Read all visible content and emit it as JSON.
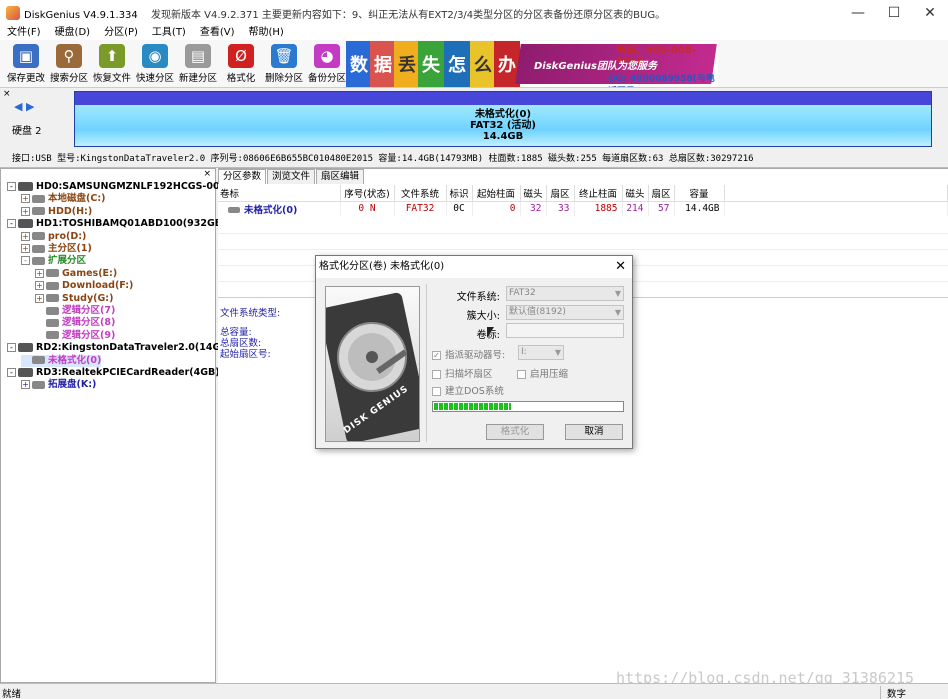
{
  "window": {
    "app_title": "DiskGenius V4.9.1.334",
    "update_notice": "发现新版本 V4.9.2.371 主要更新内容如下：9、纠正无法从有EXT2/3/4类型分区的分区表备份还原分区表的BUG。",
    "minimize": "—",
    "maximize": "☐",
    "close": "✕"
  },
  "menu": [
    "文件(F)",
    "硬盘(D)",
    "分区(P)",
    "工具(T)",
    "查看(V)",
    "帮助(H)"
  ],
  "toolbar": {
    "buttons": [
      {
        "label": "保存更改",
        "icon": "save-icon",
        "color": "#3a6fc4",
        "glyph": "▣"
      },
      {
        "label": "搜索分区",
        "icon": "search-icon",
        "color": "#9a6a3a",
        "glyph": "⚲"
      },
      {
        "label": "恢复文件",
        "icon": "recover-file-icon",
        "color": "#7a9a2a",
        "glyph": "⬆"
      },
      {
        "label": "快速分区",
        "icon": "quick-partition-icon",
        "color": "#2a8ac4",
        "glyph": "◉"
      },
      {
        "label": "新建分区",
        "icon": "new-partition-icon",
        "color": "#9a9a9a",
        "glyph": "▤"
      },
      {
        "label": "格式化",
        "icon": "format-icon",
        "color": "#d02020",
        "glyph": "Ø"
      },
      {
        "label": "删除分区",
        "icon": "delete-partition-icon",
        "color": "#2a7ad0",
        "glyph": "🗑"
      },
      {
        "label": "备份分区",
        "icon": "backup-partition-icon",
        "color": "#c43cc4",
        "glyph": "◕"
      }
    ]
  },
  "banner": {
    "tiles": [
      "数",
      "据",
      "丢",
      "失",
      "怎",
      "么",
      "办"
    ],
    "slogan": "DiskGenius团队为您服务",
    "phone": "电话：400-008-9958",
    "qq": "QQ: 4000089958(与电话同号)"
  },
  "disk_panel": {
    "close": "×",
    "nav": "◀ ▶",
    "disk_label": "硬盘 2",
    "bar_line1": "未格式化(0)",
    "bar_line2": "FAT32 (活动)",
    "bar_line3": "14.4GB",
    "info": "接口:USB  型号:KingstonDataTraveler2.0  序列号:08606E6B655BC010480E2015  容量:14.4GB(14793MB)  柱面数:1885  磁头数:255  每道扇区数:63  总扇区数:30297216"
  },
  "tree": {
    "close": "×",
    "nodes": [
      {
        "text": "HD0:SAMSUNGMZNLF192HCGS-00000(17",
        "level": 0,
        "exp": "-",
        "color": "black",
        "disk": true
      },
      {
        "text": "本地磁盘(C:)",
        "level": 1,
        "exp": "+",
        "color": "brown"
      },
      {
        "text": "HDD(H:)",
        "level": 1,
        "exp": "+",
        "color": "brown"
      },
      {
        "text": "HD1:TOSHIBAMQ01ABD100(932GB)",
        "level": 0,
        "exp": "-",
        "color": "black",
        "disk": true
      },
      {
        "text": "pro(D:)",
        "level": 1,
        "exp": "+",
        "color": "brown"
      },
      {
        "text": "主分区(1)",
        "level": 1,
        "exp": "+",
        "color": "brown"
      },
      {
        "text": "扩展分区",
        "level": 1,
        "exp": "-",
        "color": "green"
      },
      {
        "text": "Games(E:)",
        "level": 2,
        "exp": "+",
        "color": "brown"
      },
      {
        "text": "Download(F:)",
        "level": 2,
        "exp": "+",
        "color": "brown"
      },
      {
        "text": "Study(G:)",
        "level": 2,
        "exp": "+",
        "color": "brown"
      },
      {
        "text": "逻辑分区(7)",
        "level": 2,
        "exp": "",
        "color": "purple"
      },
      {
        "text": "逻辑分区(8)",
        "level": 2,
        "exp": "",
        "color": "purple"
      },
      {
        "text": "逻辑分区(9)",
        "level": 2,
        "exp": "",
        "color": "purple"
      },
      {
        "text": "RD2:KingstonDataTraveler2.0(14GB",
        "level": 0,
        "exp": "-",
        "color": "black",
        "disk": true
      },
      {
        "text": "未格式化(0)",
        "level": 1,
        "exp": "",
        "color": "purple",
        "selected": true
      },
      {
        "text": "RD3:RealtekPCIECardReader(4GB)",
        "level": 0,
        "exp": "-",
        "color": "black",
        "disk": true
      },
      {
        "text": "拓展盘(K:)",
        "level": 1,
        "exp": "+",
        "color": "blue"
      }
    ]
  },
  "tabs": [
    "分区参数",
    "浏览文件",
    "扇区编辑"
  ],
  "partition_table": {
    "headers": [
      "卷标",
      "序号(状态)",
      "文件系统",
      "标识",
      "起始柱面",
      "磁头",
      "扇区",
      "终止柱面",
      "磁头",
      "扇区",
      "容量"
    ],
    "row": [
      "未格式化(0)",
      "0 N",
      "FAT32",
      "0C",
      "0",
      "32",
      "33",
      "1885",
      "214",
      "57",
      "14.4GB"
    ]
  },
  "fs_section": {
    "type_label": "文件系统类型:",
    "stats": [
      "总容量:",
      "总扇区数:",
      "起始扇区号:"
    ]
  },
  "watermark": "https://blog.csdn.net/qq_31386215",
  "status": {
    "text": "就绪",
    "mode": "数字"
  },
  "dialog": {
    "title": "格式化分区(卷) 未格式化(0)",
    "close": "✕",
    "image_text": "DISK GENIUS",
    "fs_label": "文件系统:",
    "fs_value": "FAT32",
    "cluster_label": "簇大小:",
    "cluster_value": "默认值(8192)",
    "volume_label": "卷标:",
    "drive_letter_label": "指派驱动器号:",
    "drive_letter_value": "I:",
    "scan_bad_label": "扫描坏扇区",
    "compress_label": "启用压缩",
    "dos_label": "建立DOS系统",
    "progress": 0.41,
    "format_button": "格式化",
    "cancel_button": "取消"
  }
}
